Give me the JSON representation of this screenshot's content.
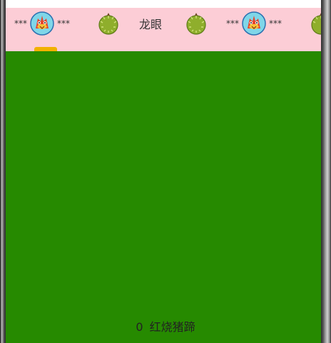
{
  "tabs": [
    {
      "kind": "dragon",
      "prefix": "***",
      "suffix": "***",
      "icon": "dragon-avatar-icon"
    },
    {
      "kind": "durian",
      "icon": "durian-icon"
    },
    {
      "kind": "text",
      "label": "龙眼"
    },
    {
      "kind": "durian",
      "icon": "durian-icon"
    },
    {
      "kind": "dragon",
      "prefix": "***",
      "suffix": "***",
      "icon": "dragon-avatar-icon"
    },
    {
      "kind": "durian-partial",
      "icon": "durian-icon"
    }
  ],
  "selected_tab_index": 0,
  "colors": {
    "tab_bar_bg": "#fccdd6",
    "content_bg": "#268a00",
    "indicator": "#f2b100"
  },
  "content": {
    "count": "0",
    "label": "红烧猪蹄"
  }
}
